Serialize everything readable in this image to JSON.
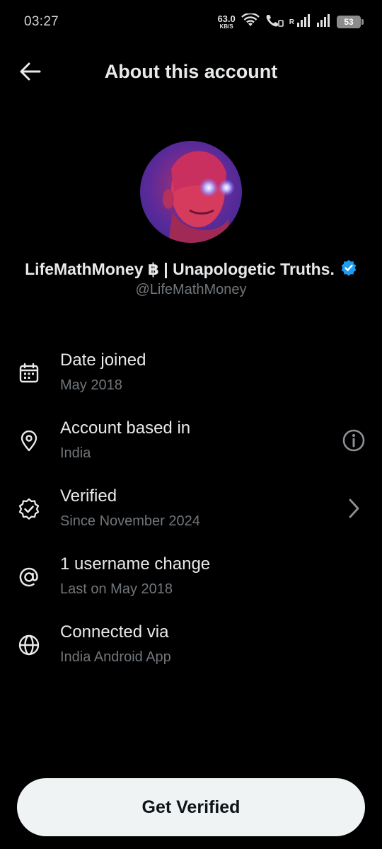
{
  "status_bar": {
    "time": "03:27",
    "net_speed": "63.0",
    "net_unit": "KB/S",
    "roaming": "R",
    "battery": "53"
  },
  "header": {
    "title": "About this account",
    "back_icon": "arrow-left-icon"
  },
  "profile": {
    "display_name": "LifeMathMoney ฿ | Unapologetic Truths.",
    "handle": "@LifeMathMoney",
    "verified_color": "#1d9bf0"
  },
  "info_rows": [
    {
      "icon": "calendar-icon",
      "title": "Date joined",
      "subtitle": "May 2018"
    },
    {
      "icon": "location-pin-icon",
      "title": "Account based in",
      "subtitle": "India",
      "action_icon": "info-icon"
    },
    {
      "icon": "verified-badge-icon",
      "title": "Verified",
      "subtitle": "Since November 2024",
      "action_icon": "chevron-right-icon"
    },
    {
      "icon": "at-sign-icon",
      "title": "1 username change",
      "subtitle": "Last on May 2018"
    },
    {
      "icon": "globe-icon",
      "title": "Connected via",
      "subtitle": "India Android App"
    }
  ],
  "cta": {
    "label": "Get Verified"
  },
  "colors": {
    "background": "#000000",
    "text_primary": "#e7e9ea",
    "text_secondary": "#71767b",
    "button_bg": "#eff3f4"
  }
}
